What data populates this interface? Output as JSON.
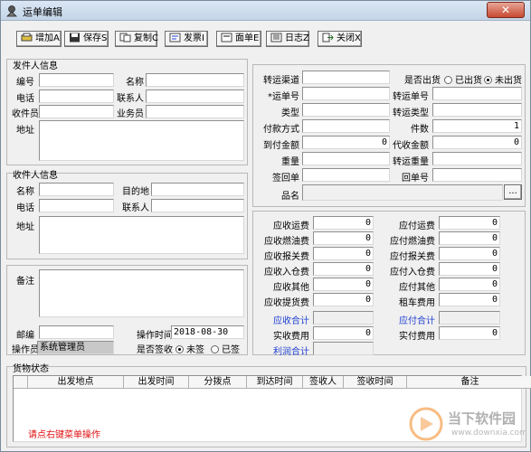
{
  "window": {
    "title": "运单编辑",
    "close_glyph": "✕"
  },
  "toolbar": {
    "add": "增加A",
    "save": "保存S",
    "copy": "复制C",
    "invoice": "发票I",
    "face_sheet": "面单E",
    "log": "日志Z",
    "close": "关闭X"
  },
  "sender": {
    "group_title": "发件人信息",
    "code_label": "编号",
    "name_label": "名称",
    "phone_label": "电话",
    "contact_label": "联系人",
    "receiver_staff_label": "收件员",
    "salesman_label": "业务员",
    "address_label": "地址"
  },
  "recipient": {
    "group_title": "收件人信息",
    "name_label": "名称",
    "destination_label": "目的地",
    "phone_label": "电话",
    "contact_label": "联系人",
    "address_label": "地址"
  },
  "notes": {
    "remark_label": "备注",
    "postcode_label": "邮编",
    "optime_label": "操作时间",
    "optime_value": "2018-08-30",
    "operator_label": "操作员",
    "operator_value": "系统管理员",
    "signed_label": "是否签收",
    "unsigned_option": "未签",
    "signed_option": "已签"
  },
  "shipping": {
    "channel_label": "转运渠道",
    "shipped_label": "是否出货",
    "shipped_option": "已出货",
    "not_shipped_option": "未出货",
    "waybill_label": "*运单号",
    "transfer_no_label": "转运单号",
    "type_label": "类型",
    "transfer_type_label": "转运类型",
    "payment_label": "付款方式",
    "pieces_label": "件数",
    "pieces_value": "1",
    "cod_amount_label": "到付金额",
    "cod_amount_value": "0",
    "collect_amount_label": "代收金额",
    "collect_amount_value": "0",
    "weight_label": "重量",
    "transfer_weight_label": "转运重量",
    "sign_back_label": "签回单",
    "return_no_label": "回单号",
    "product_label": "品名",
    "product_browse": "..."
  },
  "fees": {
    "receivable": [
      {
        "label": "应收运费",
        "value": "0"
      },
      {
        "label": "应收燃油费",
        "value": "0"
      },
      {
        "label": "应收报关费",
        "value": "0"
      },
      {
        "label": "应收入仓费",
        "value": "0"
      },
      {
        "label": "应收其他",
        "value": "0"
      },
      {
        "label": "应收提货费",
        "value": "0"
      }
    ],
    "receivable_total_label": "应收合计",
    "actual_receipt_label": "实收费用",
    "actual_receipt_value": "0",
    "profit_total_label": "利润合计",
    "payable": [
      {
        "label": "应付运费",
        "value": "0"
      },
      {
        "label": "应付燃油费",
        "value": "0"
      },
      {
        "label": "应付报关费",
        "value": "0"
      },
      {
        "label": "应付入仓费",
        "value": "0"
      },
      {
        "label": "应付其他",
        "value": "0"
      },
      {
        "label": "租车费用",
        "value": "0"
      }
    ],
    "payable_total_label": "应付合计",
    "actual_payment_label": "实付费用",
    "actual_payment_value": "0"
  },
  "cargo_status": {
    "group_title": "货物状态",
    "columns": [
      "出发地点",
      "出发时间",
      "分拨点",
      "到达时间",
      "签收人",
      "签收时间",
      "备注"
    ],
    "hint": "请点右键菜单操作"
  },
  "watermark": {
    "line1": "当下软件园",
    "line2": "www.downxia.com"
  },
  "colors": {
    "accent_blue": "#1f3fd0",
    "hint_red": "#e01010",
    "watermark_orange": "#f08a2a"
  }
}
